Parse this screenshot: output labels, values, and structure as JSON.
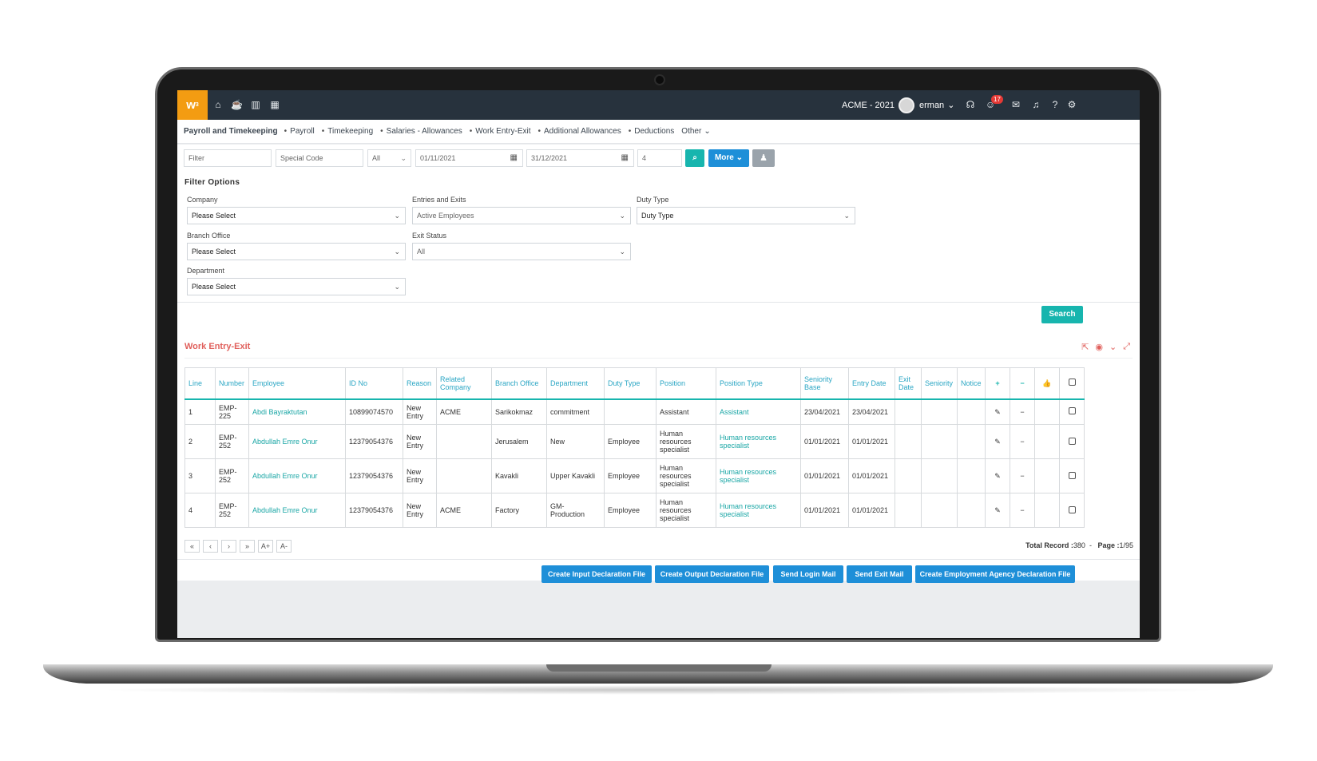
{
  "app": {
    "logo": "w",
    "company_year": "ACME - 2021",
    "user": "erman",
    "notification_count": "17"
  },
  "subnav": {
    "active": "Payroll and Timekeeping",
    "items": [
      "Payroll",
      "Timekeeping",
      "Salaries - Allowances",
      "Work Entry-Exit",
      "Additional Allowances",
      "Deductions"
    ],
    "other": "Other"
  },
  "filters": {
    "filter_placeholder": "Filter",
    "special_code_placeholder": "Special Code",
    "all_select": "All",
    "date_from": "01/11/2021",
    "date_to": "31/12/2021",
    "count": "4",
    "more_label": "More"
  },
  "filter_options": {
    "title": "Filter Options",
    "company_label": "Company",
    "company_value": "Please Select",
    "entries_label": "Entries and Exits",
    "entries_value": "Active Employees",
    "duty_label": "Duty Type",
    "duty_value": "Duty Type",
    "branch_label": "Branch Office",
    "branch_value": "Please Select",
    "exit_label": "Exit Status",
    "exit_value": "All",
    "dept_label": "Department",
    "dept_value": "Please Select",
    "search_label": "Search"
  },
  "grid": {
    "title": "Work Entry-Exit",
    "columns": [
      "Line",
      "Number",
      "Employee",
      "ID No",
      "Reason",
      "Related Company",
      "Branch Office",
      "Department",
      "Duty Type",
      "Position",
      "Position Type",
      "Seniority Base",
      "Entry Date",
      "Exit Date",
      "Seniority",
      "Notice"
    ],
    "rows": [
      {
        "line": "1",
        "number": "EMP-225",
        "employee": "Abdi Bayraktutan",
        "id": "10899074570",
        "reason": "New Entry",
        "company": "ACME",
        "branch": "Sarikokmaz",
        "dept": "commitment",
        "duty": "",
        "position": "Assistant",
        "ptype": "Assistant",
        "sbase": "23/04/2021",
        "entry": "23/04/2021",
        "exit": "",
        "seniority": "",
        "notice": ""
      },
      {
        "line": "2",
        "number": "EMP-252",
        "employee": "Abdullah Emre Onur",
        "id": "12379054376",
        "reason": "New Entry",
        "company": "",
        "branch": "Jerusalem",
        "dept": "New",
        "duty": "Employee",
        "position": "Human resources specialist",
        "ptype": "Human resources specialist",
        "sbase": "01/01/2021",
        "entry": "01/01/2021",
        "exit": "",
        "seniority": "",
        "notice": ""
      },
      {
        "line": "3",
        "number": "EMP-252",
        "employee": "Abdullah Emre Onur",
        "id": "12379054376",
        "reason": "New Entry",
        "company": "",
        "branch": "Kavakli",
        "dept": "Upper Kavakli",
        "duty": "Employee",
        "position": "Human resources specialist",
        "ptype": "Human resources specialist",
        "sbase": "01/01/2021",
        "entry": "01/01/2021",
        "exit": "",
        "seniority": "",
        "notice": ""
      },
      {
        "line": "4",
        "number": "EMP-252",
        "employee": "Abdullah Emre Onur",
        "id": "12379054376",
        "reason": "New Entry",
        "company": "ACME",
        "branch": "Factory",
        "dept": "GM- Production",
        "duty": "Employee",
        "position": "Human resources specialist",
        "ptype": "Human resources specialist",
        "sbase": "01/01/2021",
        "entry": "01/01/2021",
        "exit": "",
        "seniority": "",
        "notice": ""
      }
    ],
    "pager": [
      "«",
      "‹",
      "›",
      "»",
      "A+",
      "A-"
    ],
    "total_label": "Total Record :",
    "total_value": "380",
    "page_label": "Page :",
    "page_value": "1/95"
  },
  "actions": [
    "Create Input Declaration File",
    "Create Output Declaration File",
    "Send Login Mail",
    "Send Exit Mail",
    "Create Employment Agency Declaration File"
  ],
  "colors": {
    "topbar": "#27323d",
    "logo": "#f39c12",
    "teal": "#17b5ae",
    "blue": "#1e8fd8",
    "grid_title": "#e0605c",
    "badge": "#e53935"
  },
  "icons": [
    "home-icon",
    "coffee-icon",
    "chart-icon",
    "calendar-icon",
    "headset-icon",
    "smile-icon",
    "chat-icon",
    "bell-icon",
    "help-icon",
    "gear-icon",
    "search-icon",
    "user-x-icon",
    "export-icon",
    "eye-icon",
    "collapse-icon",
    "expand-icon",
    "pencil-icon",
    "minus-icon",
    "plus-icon",
    "thumbs-up-icon"
  ]
}
